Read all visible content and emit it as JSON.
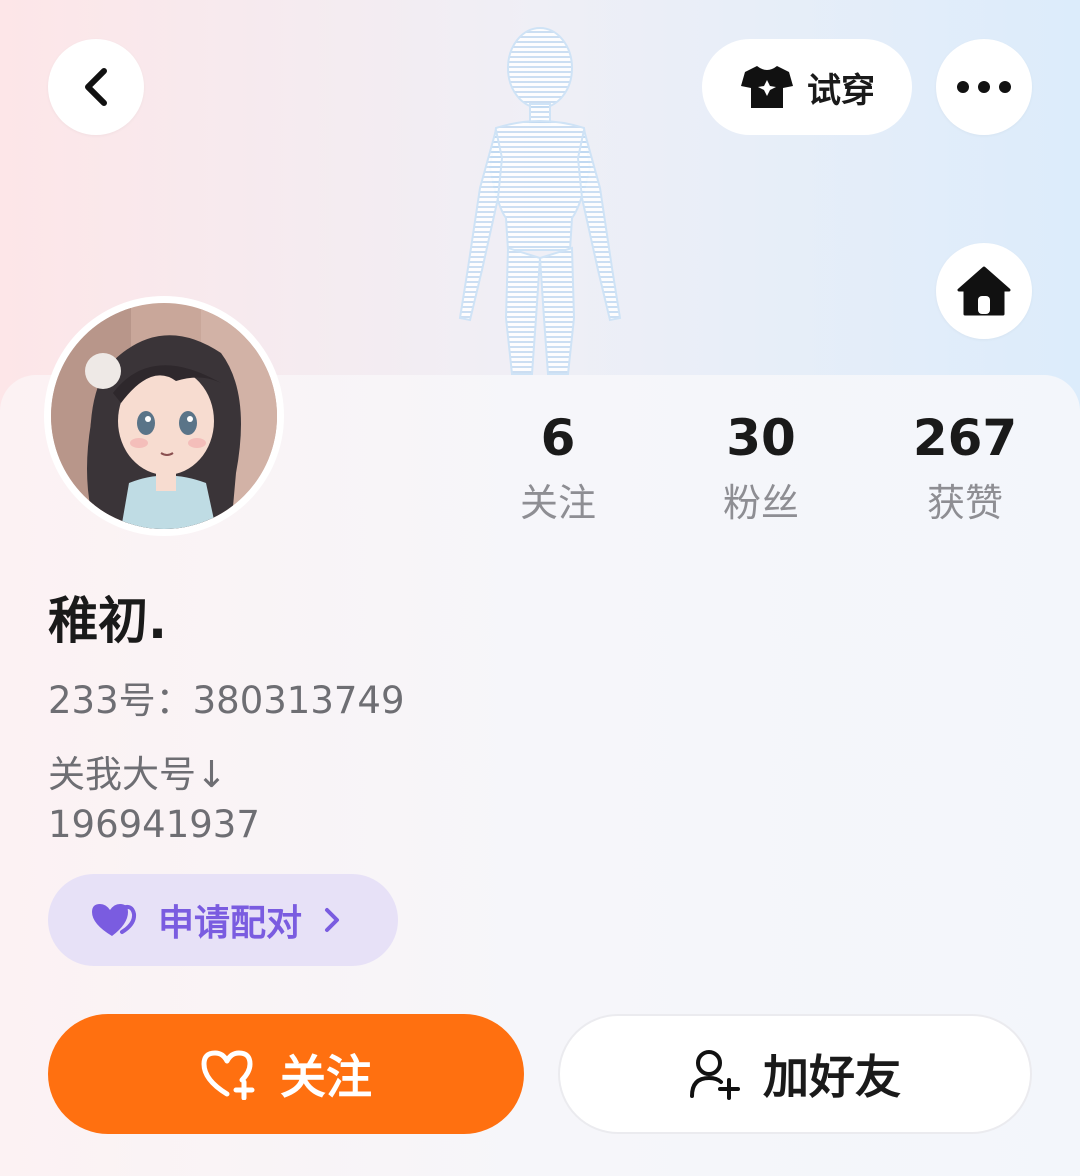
{
  "header": {
    "back_icon": "chevron-left-icon",
    "try_on": {
      "icon": "tshirt-icon",
      "label": "试穿"
    },
    "more_icon": "more-dots-icon",
    "home_icon": "home-icon"
  },
  "profile": {
    "avatar_icon": "anime-girl-avatar",
    "stats": {
      "following": {
        "value": "6",
        "label": "关注"
      },
      "fans": {
        "value": "30",
        "label": "粉丝"
      },
      "likes": {
        "value": "267",
        "label": "获赞"
      }
    },
    "username": "稚初.",
    "uid_label": "233号：",
    "uid_value": "380313749",
    "bio_line1": "关我大号↓",
    "bio_line2": "196941937"
  },
  "actions": {
    "pair": {
      "icon": "double-heart-icon",
      "label": "申请配对",
      "chevron": "chevron-right-icon"
    },
    "follow": {
      "icon": "heart-plus-icon",
      "label": "关注"
    },
    "add_friend": {
      "icon": "person-add-icon",
      "label": "加好友"
    }
  },
  "colors": {
    "accent_orange": "#ff7010",
    "pair_purple": "#7a5ce0",
    "pair_bg": "#e7e1f7"
  }
}
